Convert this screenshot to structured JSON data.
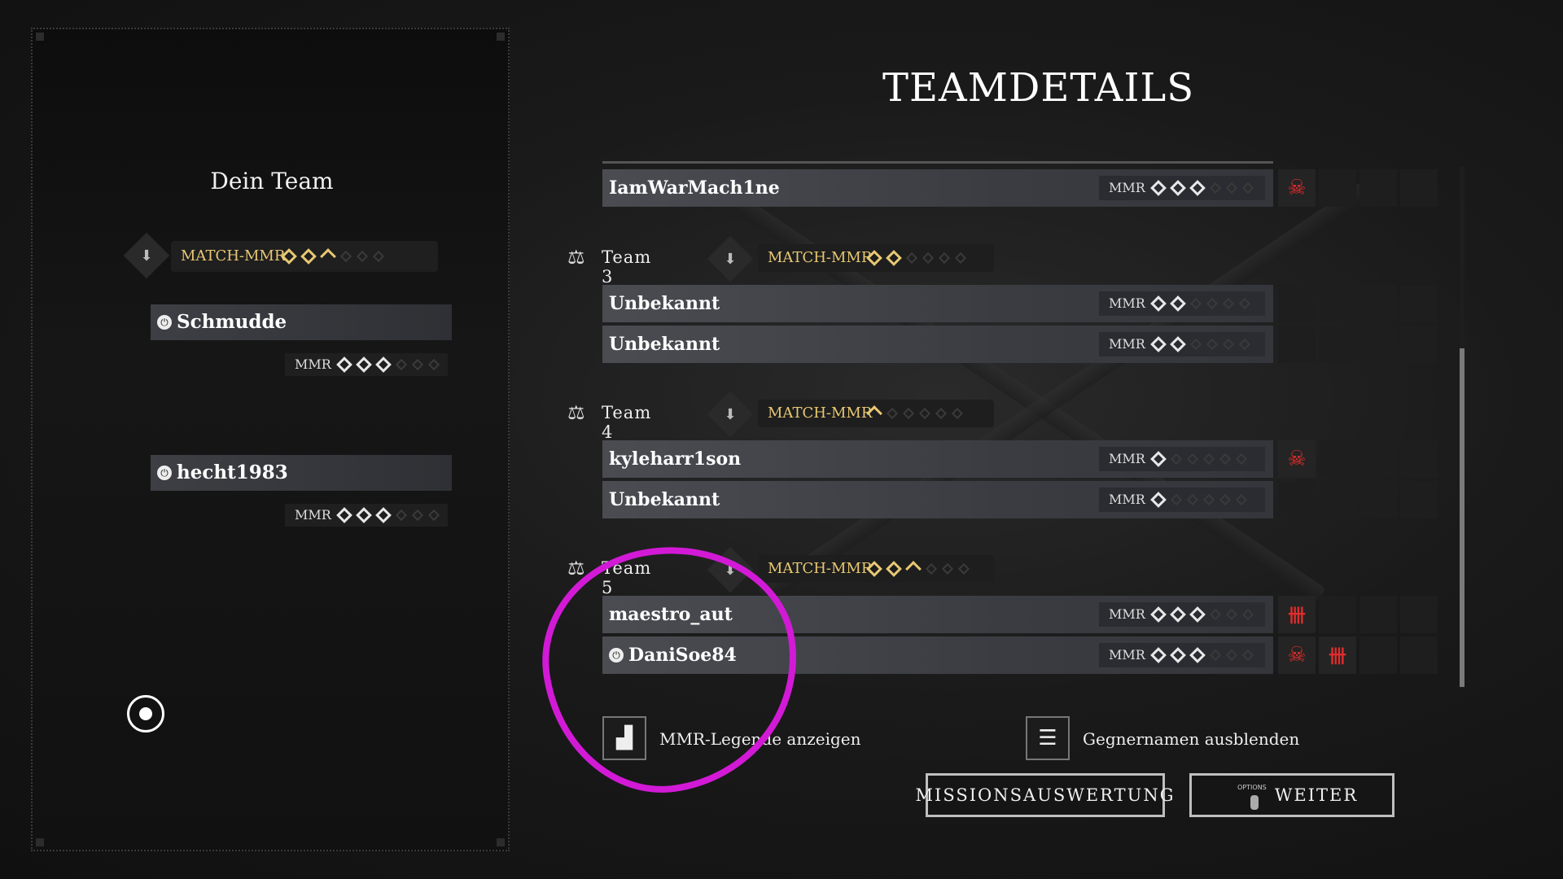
{
  "left_panel": {
    "title": "Dein Team",
    "match_mmr_label": "MATCH-MMR",
    "players": [
      {
        "name": "Schmudde",
        "mmr_label": "MMR"
      },
      {
        "name": "hecht1983",
        "mmr_label": "MMR"
      }
    ]
  },
  "main": {
    "title": "TEAMDETAILS",
    "top_player": {
      "name": "IamWarMach1ne",
      "mmr_label": "MMR"
    },
    "teams": [
      {
        "name": "Team 3",
        "match_mmr_label": "MATCH-MMR",
        "players": [
          {
            "name": "Unbekannt",
            "mmr_label": "MMR"
          },
          {
            "name": "Unbekannt",
            "mmr_label": "MMR"
          }
        ]
      },
      {
        "name": "Team 4",
        "match_mmr_label": "MATCH-MMR",
        "players": [
          {
            "name": "kyleharr1son",
            "mmr_label": "MMR"
          },
          {
            "name": "Unbekannt",
            "mmr_label": "MMR"
          }
        ]
      },
      {
        "name": "Team 5",
        "match_mmr_label": "MATCH-MMR",
        "players": [
          {
            "name": "maestro_aut",
            "mmr_label": "MMR"
          },
          {
            "name": "DaniSoe84",
            "mmr_label": "MMR"
          }
        ]
      }
    ]
  },
  "options": {
    "mmr_legend": "MMR-Legende anzeigen",
    "hide_names": "Gegnernamen ausblenden"
  },
  "buttons": {
    "mission": "MISSIONSAUSWERTUNG",
    "options_tag": "OPTIONS",
    "next": "WEITER"
  },
  "colors": {
    "accent_gold": "#e8c873",
    "kill_red": "#e02c2c",
    "annotation": "#d21ad6"
  }
}
